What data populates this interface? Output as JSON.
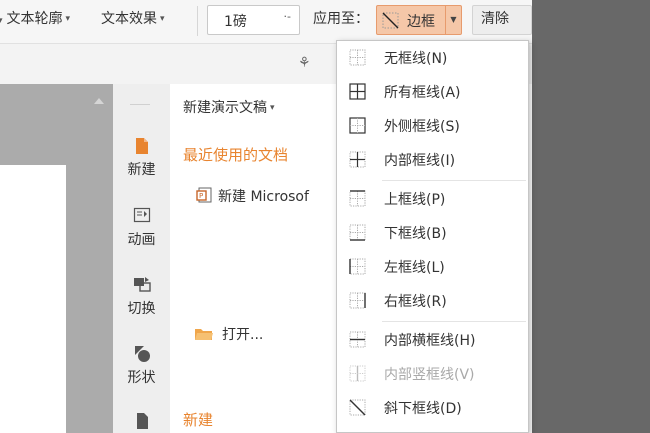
{
  "toolbar": {
    "text_outline": "文本轮廓",
    "text_effect": "文本效果",
    "size_value": "1磅",
    "size_control": "·-",
    "apply_to": "应用至：",
    "border_label": "边框",
    "clear_label": "清除"
  },
  "task_pane": {
    "icons": [
      {
        "label": "新建",
        "icon": "new-doc-icon"
      },
      {
        "label": "动画",
        "icon": "animation-icon"
      },
      {
        "label": "切换",
        "icon": "transition-icon"
      },
      {
        "label": "形状",
        "icon": "shape-icon"
      }
    ],
    "title": "新建演示文稿",
    "recent_heading": "最近使用的文档",
    "recent_item": "新建 Microsof",
    "open_label": "打开...",
    "new_heading": "新建"
  },
  "border_menu": {
    "items": [
      {
        "label": "无框线(N)",
        "icon": "no-border-icon",
        "enabled": true
      },
      {
        "label": "所有框线(A)",
        "icon": "all-borders-icon",
        "enabled": true
      },
      {
        "label": "外侧框线(S)",
        "icon": "outside-borders-icon",
        "enabled": true
      },
      {
        "label": "内部框线(I)",
        "icon": "inside-borders-icon",
        "enabled": true
      },
      {
        "label": "上框线(P)",
        "icon": "top-border-icon",
        "enabled": true
      },
      {
        "label": "下框线(B)",
        "icon": "bottom-border-icon",
        "enabled": true
      },
      {
        "label": "左框线(L)",
        "icon": "left-border-icon",
        "enabled": true
      },
      {
        "label": "右框线(R)",
        "icon": "right-border-icon",
        "enabled": true
      },
      {
        "label": "内部横框线(H)",
        "icon": "inside-horizontal-border-icon",
        "enabled": true
      },
      {
        "label": "内部竖框线(V)",
        "icon": "inside-vertical-border-icon",
        "enabled": false
      },
      {
        "label": "斜下框线(D)",
        "icon": "diagonal-down-border-icon",
        "enabled": true
      }
    ]
  },
  "colors": {
    "accent_orange": "#e8842f",
    "border_button_bg": "#f5c7a8",
    "border_button_stroke": "#e79b6d"
  }
}
